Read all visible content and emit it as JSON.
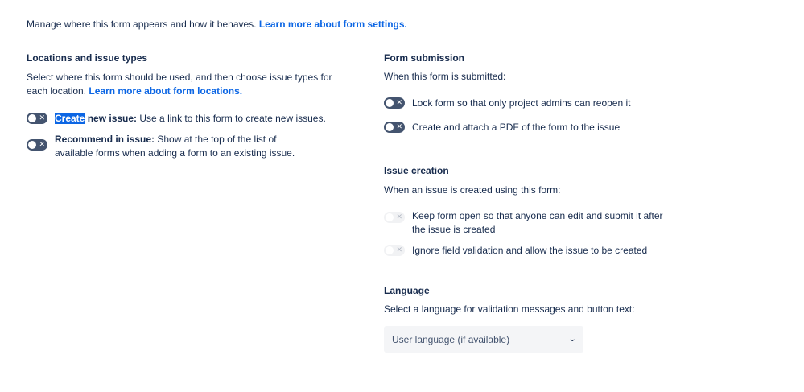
{
  "intro": {
    "text": "Manage where this form appears and how it behaves. ",
    "link": "Learn more about form settings."
  },
  "locations": {
    "title": "Locations and issue types",
    "desc": "Select where this form should be used, and then choose issue types for each location. ",
    "link": "Learn more about form locations.",
    "options": [
      {
        "bold_highlight": "Create",
        "bold_rest": " new issue:",
        "text": " Use a link to this form to create new issues.",
        "enabled": false
      },
      {
        "bold": "Recommend in issue:",
        "text": " Show at the top of the list of available forms when adding a form to an existing issue.",
        "enabled": false
      }
    ]
  },
  "submission": {
    "title": "Form submission",
    "desc": "When this form is submitted:",
    "options": [
      {
        "text": "Lock form so that only project admins can reopen it",
        "enabled": false
      },
      {
        "text": "Create and attach a PDF of the form to the issue",
        "enabled": false
      }
    ]
  },
  "creation": {
    "title": "Issue creation",
    "desc": "When an issue is created using this form:",
    "options": [
      {
        "text": "Keep form open so that anyone can edit and submit it after the issue is created",
        "disabled": true
      },
      {
        "text": "Ignore field validation and allow the issue to be created",
        "disabled": true
      }
    ]
  },
  "language": {
    "title": "Language",
    "desc": "Select a language for validation messages and button text:",
    "select_value": "User language (if available)"
  },
  "icons": {
    "toggle_off": "✕",
    "chevron": "⌄"
  }
}
